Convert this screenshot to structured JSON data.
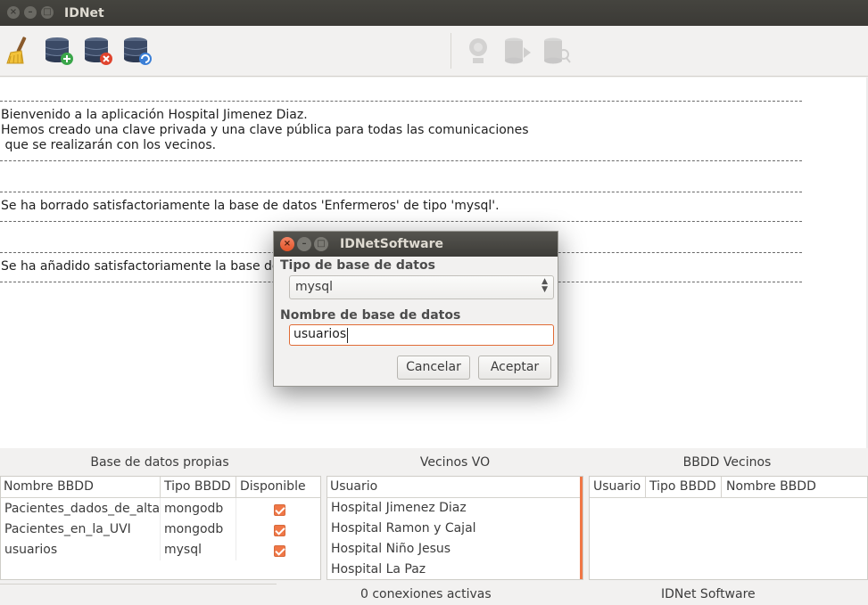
{
  "window": {
    "title": "IDNet"
  },
  "toolbar": {
    "buttons": [
      {
        "icon": "broom-icon",
        "enabled": true
      },
      {
        "icon": "database-add-icon",
        "enabled": true
      },
      {
        "icon": "database-delete-icon",
        "enabled": true
      },
      {
        "icon": "database-refresh-icon",
        "enabled": true
      },
      {
        "icon": "network-icon",
        "enabled": false
      },
      {
        "icon": "database-send-icon",
        "enabled": false
      },
      {
        "icon": "database-search-icon",
        "enabled": false
      }
    ]
  },
  "log": {
    "welcome1": "Bienvenido a la aplicación Hospital Jimenez Diaz.",
    "welcome2": "Hemos creado una clave privada y una clave pública para todas las comunicaciones",
    "welcome3": " que se realizarán con los vecinos.",
    "deleted": "Se ha borrado satisfactoriamente la base de datos 'Enfermeros' de tipo 'mysql'.",
    "added": "Se ha añadido satisfactoriamente la base de d"
  },
  "own_db": {
    "title": "Base de datos propias",
    "columns": [
      "Nombre BBDD",
      "Tipo BBDD",
      "Disponible"
    ],
    "rows": [
      {
        "name": "Pacientes_dados_de_alta",
        "type": "mongodb",
        "available": true
      },
      {
        "name": "Pacientes_en_la_UVI",
        "type": "mongodb",
        "available": true
      },
      {
        "name": "usuarios",
        "type": "mysql",
        "available": true
      }
    ]
  },
  "neighbors": {
    "title": "Vecinos VO",
    "column": "Usuario",
    "rows": [
      "Hospital Jimenez Diaz",
      "Hospital Ramon y Cajal",
      "Hospital Niño Jesus",
      "Hospital La Paz"
    ]
  },
  "neighbor_db": {
    "title": "BBDD Vecinos",
    "columns": [
      "Usuario",
      "Tipo BBDD",
      "Nombre BBDD"
    ]
  },
  "status": {
    "connections": "0 conexiones activas",
    "app": "IDNet Software"
  },
  "dialog": {
    "title": "IDNetSoftware",
    "db_type_label": "Tipo de base de datos",
    "db_type_value": "mysql",
    "db_name_label": "Nombre de base de datos",
    "db_name_value": "usuarios",
    "cancel": "Cancelar",
    "accept": "Aceptar"
  },
  "colors": {
    "accent": "#f07746",
    "titlebar": "#3c3b37"
  }
}
